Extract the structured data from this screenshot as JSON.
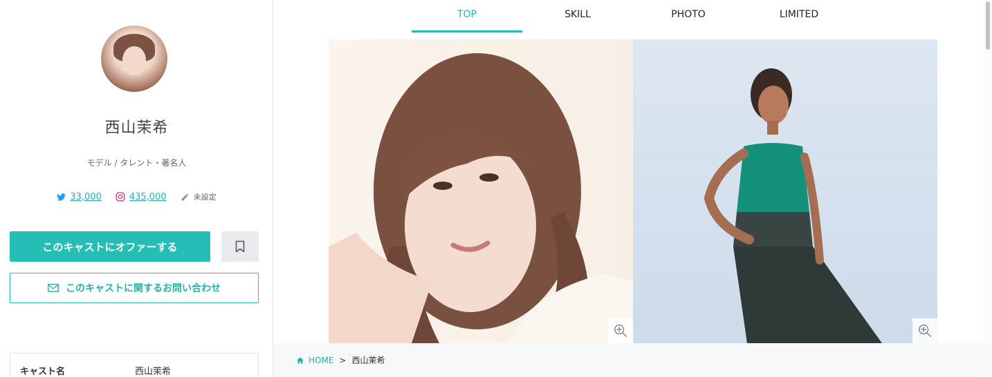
{
  "profile": {
    "name": "西山茉希",
    "category": "モデル / タレント・著名人",
    "twitter_count": "33,000",
    "instagram_count": "435,000",
    "other_label": "未設定"
  },
  "actions": {
    "offer_label": "このキャストにオファーする",
    "inquiry_label": "このキャストに関するお問い合わせ"
  },
  "info_table": [
    {
      "key": "キャスト名",
      "value": "西山茉希"
    }
  ],
  "tabs": [
    {
      "label": "TOP",
      "active": true
    },
    {
      "label": "SKILL",
      "active": false
    },
    {
      "label": "PHOTO",
      "active": false
    },
    {
      "label": "LIMITED",
      "active": false
    }
  ],
  "breadcrumb": {
    "home": "HOME",
    "separator": ">",
    "current": "西山茉希"
  },
  "colors": {
    "accent": "#25bdb5",
    "accent_text": "#1fb5ad",
    "twitter": "#1da1f2",
    "instagram": "#c13584"
  },
  "icons": [
    "twitter-icon",
    "instagram-icon",
    "pencil-icon",
    "bookmark-icon",
    "mail-icon",
    "zoom-icon",
    "home-icon"
  ]
}
